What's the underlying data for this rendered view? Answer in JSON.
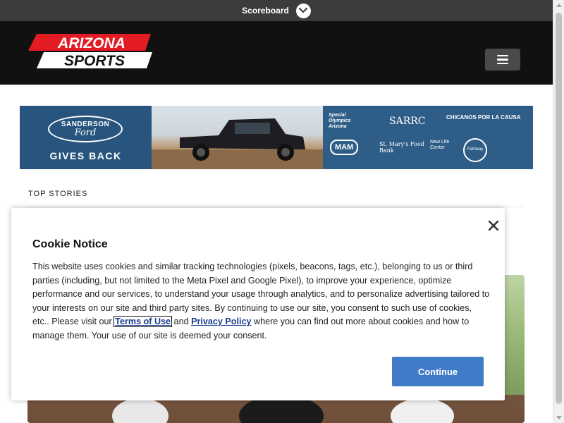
{
  "scoreboard": {
    "label": "Scoreboard",
    "toggle_icon": "chevron-down-icon"
  },
  "header": {
    "logo_line1": "ARIZONA",
    "logo_line2": "SPORTS",
    "brand_red": "#e31b23",
    "menu_icon": "hamburger-icon"
  },
  "ad": {
    "dealer_line1": "SANDERSON",
    "dealer_line2": "Ford",
    "tagline": "GIVES BACK",
    "partners": [
      "Special Olympics Arizona",
      "SARRC",
      "CHICANOS POR LA CAUSA",
      "MAM",
      "St. Mary's Food Bank",
      "New Life Center",
      "Pathway"
    ]
  },
  "section": {
    "title": "TOP STORIES"
  },
  "cookie": {
    "title": "Cookie Notice",
    "text_before": "This website uses cookies and similar tracking technologies (pixels, beacons, tags, etc.), belonging to us or third parties (including, but not limited to the Meta Pixel and Google Pixel), to improve your experience, optimize performance and our services, to understand your usage through analytics, and to personalize advertising tailored to your interests on our site and third party sites. By continuing to use our site, you consent to such use of cookies, etc.. Please visit our ",
    "terms_link": "Terms of Use",
    "and": " and ",
    "privacy_link": "Privacy Policy",
    "text_after": " where you can find out more about cookies and how to manage them. Your use of our site is deemed your consent.",
    "button": "Continue",
    "button_color": "#3f7bc7"
  }
}
